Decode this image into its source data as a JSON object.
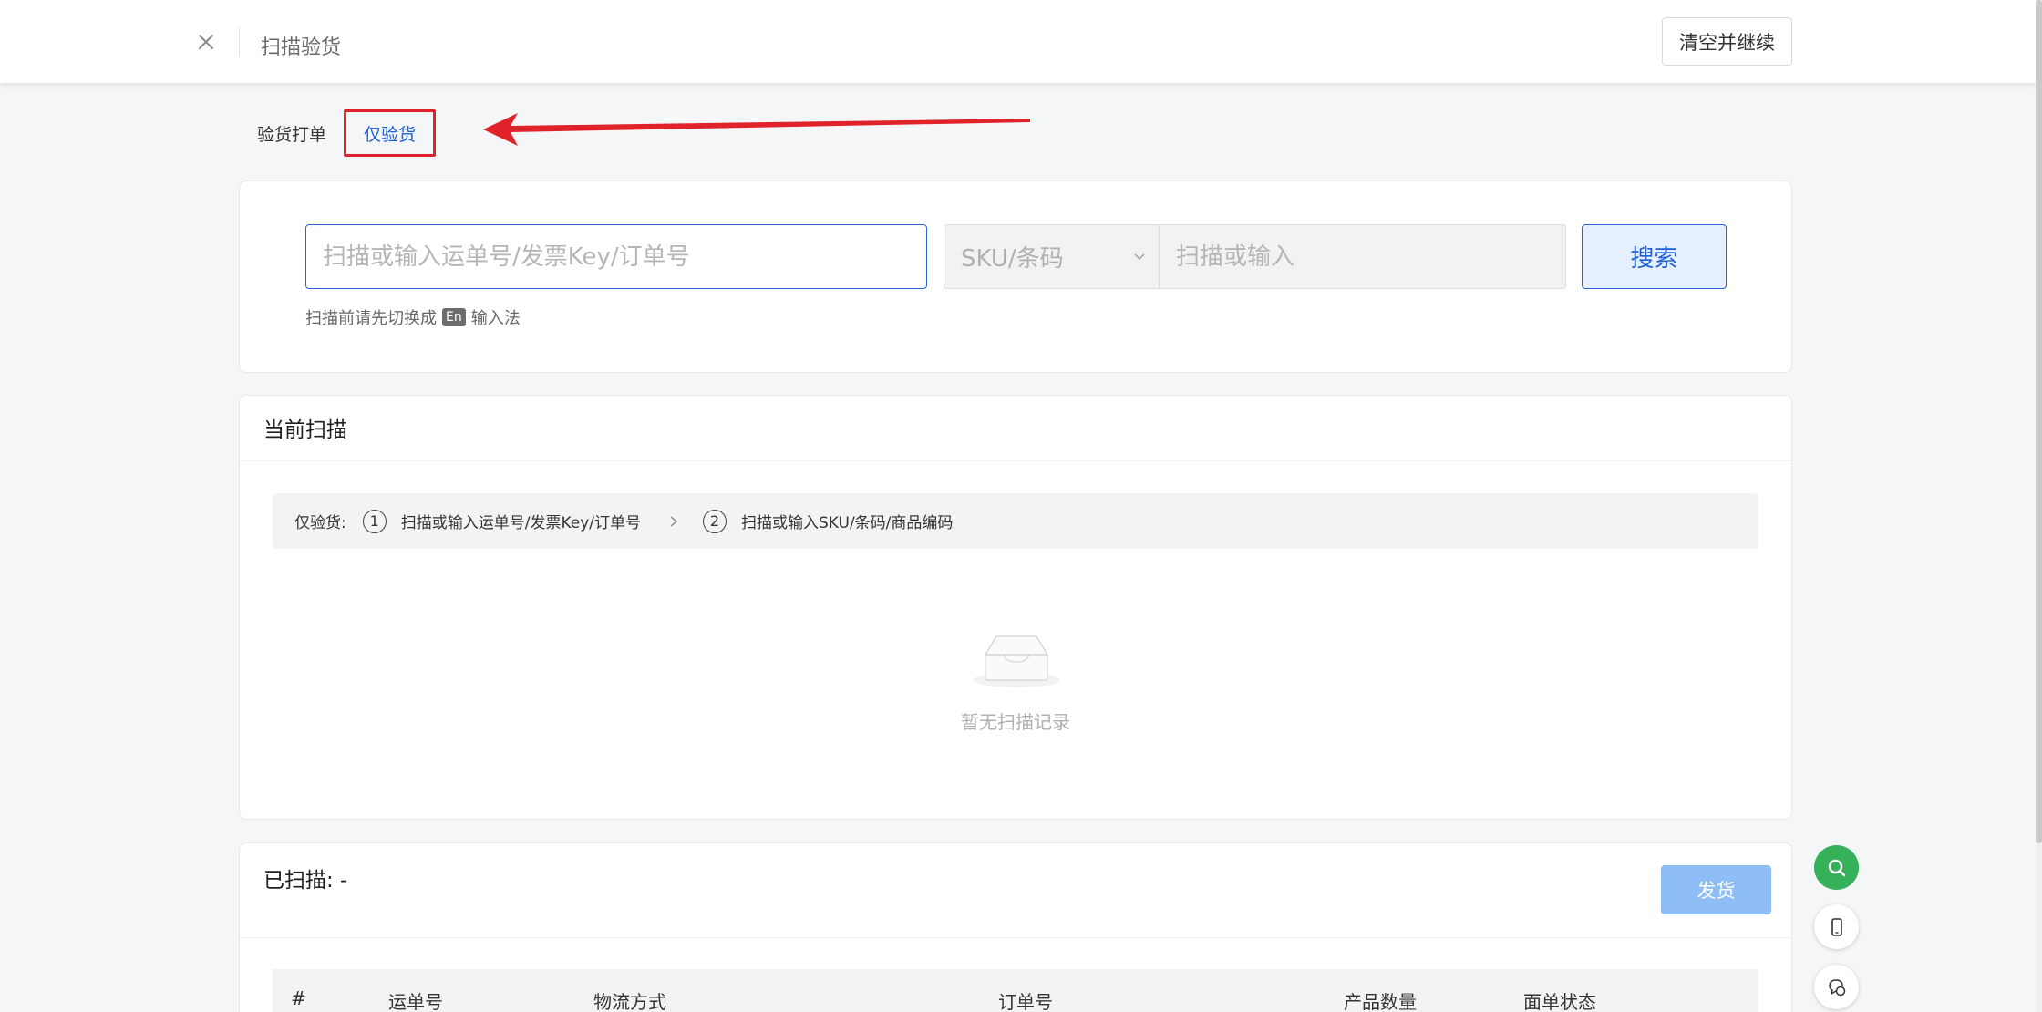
{
  "header": {
    "title": "扫描验货",
    "clear_continue_label": "清空并继续"
  },
  "tabs": [
    {
      "label": "验货打单",
      "active": false
    },
    {
      "label": "仅验货",
      "active": true
    }
  ],
  "search": {
    "tracking_placeholder": "扫描或输入运单号/发票Key/订单号",
    "sku_select_value": "SKU/条码",
    "sku_placeholder": "扫描或输入",
    "search_label": "搜索",
    "hint_before": "扫描前请先切换成",
    "hint_badge": "En",
    "hint_after": "输入法"
  },
  "current_scan": {
    "title": "当前扫描",
    "mode_label": "仅验货:",
    "step1_num": "1",
    "step1_text": "扫描或输入运单号/发票Key/订单号",
    "step2_num": "2",
    "step2_text": "扫描或输入SKU/条码/商品编码",
    "empty_text": "暂无扫描记录"
  },
  "scanned": {
    "title": "已扫描: -",
    "ship_label": "发货",
    "columns": [
      "#",
      "运单号",
      "物流方式",
      "订单号",
      "产品数量",
      "面单状态"
    ]
  },
  "colors": {
    "primary": "#1b5fd6",
    "annotation_red": "#e0232a",
    "float_green": "#35b15a",
    "ship_disabled": "#8fbdf6"
  },
  "icons": [
    "close-icon",
    "chevron-down-icon",
    "chevron-right-icon",
    "empty-inbox-icon",
    "search-icon",
    "phone-icon",
    "chat-icon",
    "arrow-annotation-icon"
  ]
}
